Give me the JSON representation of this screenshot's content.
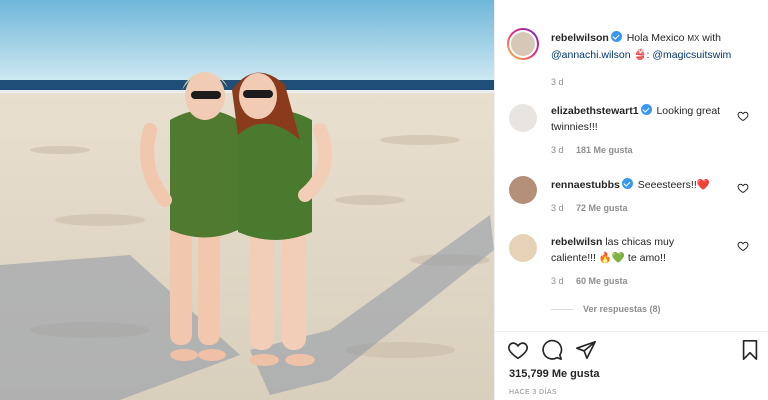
{
  "photo": {
    "description_icon": "beach-photo"
  },
  "post": {
    "author": "rebelwilson",
    "caption_parts": [
      "Hola Mexico ",
      "MX",
      " with ",
      "@annachi.wilson",
      " 👙: ",
      "@magicsuitswim"
    ],
    "time": "3 d"
  },
  "comments": [
    {
      "user": "elizabethstewart1",
      "verified": true,
      "text": "Looking great twinnies!!!",
      "time": "3 d",
      "likes": "181 Me gusta"
    },
    {
      "user": "rennaestubbs",
      "verified": true,
      "text": "Seeesteers!!❤️",
      "time": "3 d",
      "likes": "72 Me gusta"
    },
    {
      "user": "rebelwilsn",
      "verified": false,
      "text": "las chicas muy caliente!!! 🔥💚 te amo!!",
      "time": "3 d",
      "likes": "60 Me gusta"
    }
  ],
  "view_replies": "Ver respuestas (8)",
  "actions": {
    "likes": "315,799 Me gusta",
    "ago": "HACE 3 DÍAS"
  },
  "colors": {
    "verified": "#3897f0",
    "mention": "#00376b",
    "muted": "#8e8e8e"
  }
}
